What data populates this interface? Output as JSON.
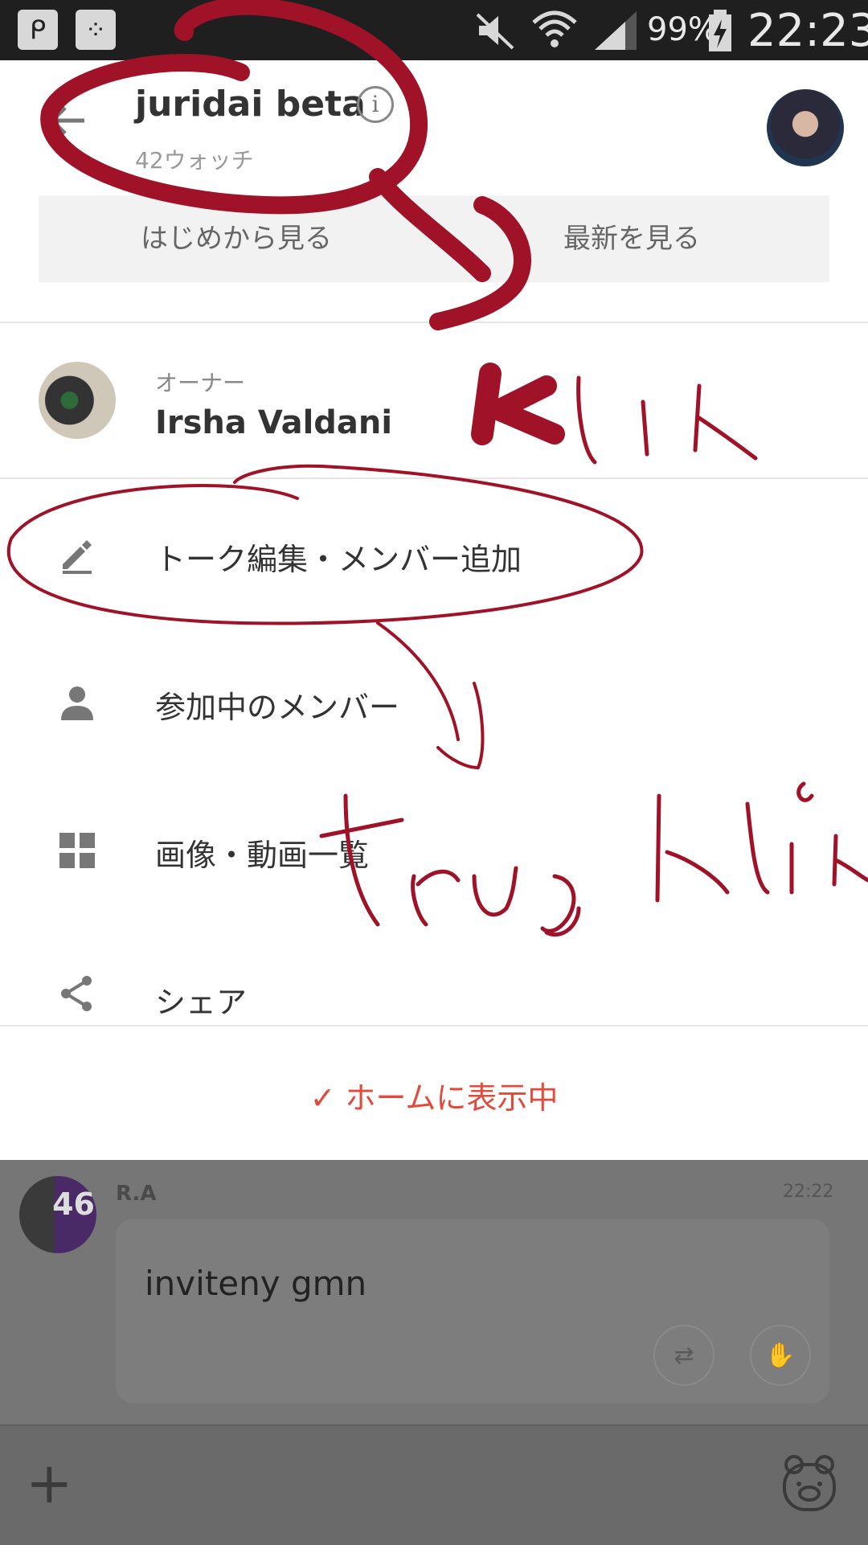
{
  "status_bar": {
    "app_icon_1": "p-app-icon",
    "app_icon_2": "bbm-icon",
    "battery_text": "99%",
    "time": "22:23",
    "icons": [
      "mute-icon",
      "wifi-icon",
      "signal-icon",
      "battery-icon"
    ]
  },
  "header": {
    "title": "juridai beta",
    "watch_count": "42ウォッチ",
    "info_icon": "info-icon",
    "back_icon": "back-arrow-icon"
  },
  "view_buttons": {
    "from_start": "はじめから見る",
    "latest": "最新を見る"
  },
  "owner": {
    "label": "オーナー",
    "name": "Irsha Valdani"
  },
  "menu": [
    {
      "icon": "pencil-icon",
      "label": "トーク編集・メンバー追加"
    },
    {
      "icon": "person-icon",
      "label": "参加中のメンバー"
    },
    {
      "icon": "grid-icon",
      "label": "画像・動画一覧"
    },
    {
      "icon": "share-icon",
      "label": "シェア"
    }
  ],
  "home_status": "✓ ホームに表示中",
  "chat": {
    "avatar_text": "46",
    "sender": "R.A",
    "time": "22:22",
    "message": "inviteny gmn"
  },
  "annotations": {
    "word_1": "klik",
    "word_2": "trus klik"
  },
  "colors": {
    "accent_red": "#e24a3b",
    "annotation_red": "#a01228",
    "status_bar": "#1f1f1f",
    "dim_overlay": "#767676"
  }
}
